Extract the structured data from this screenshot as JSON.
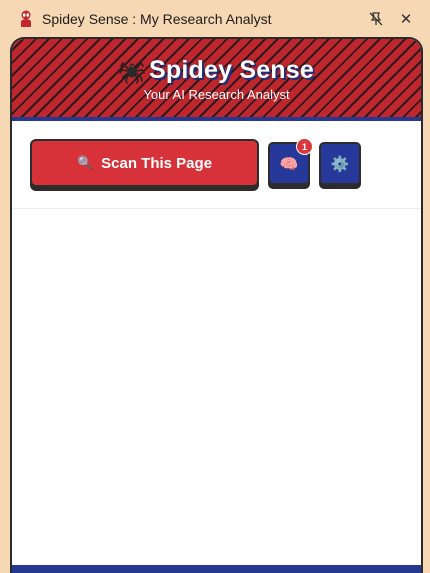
{
  "window": {
    "title": "Spidey Sense : My Research Analyst",
    "pin_icon": "unpin-icon",
    "close_glyph": "✕"
  },
  "header": {
    "title": "Spidey Sense",
    "subtitle": "Your AI Research Analyst",
    "logo_icon": "spider-icon"
  },
  "toolbar": {
    "scan_label": "Scan This Page",
    "scan_icon": "🔍",
    "brain_icon": "🧠",
    "brain_badge": "1",
    "settings_icon": "⚙️"
  },
  "colors": {
    "accent_red": "#d7323a",
    "accent_blue": "#26399a",
    "window_bg": "#f7d8b4"
  }
}
